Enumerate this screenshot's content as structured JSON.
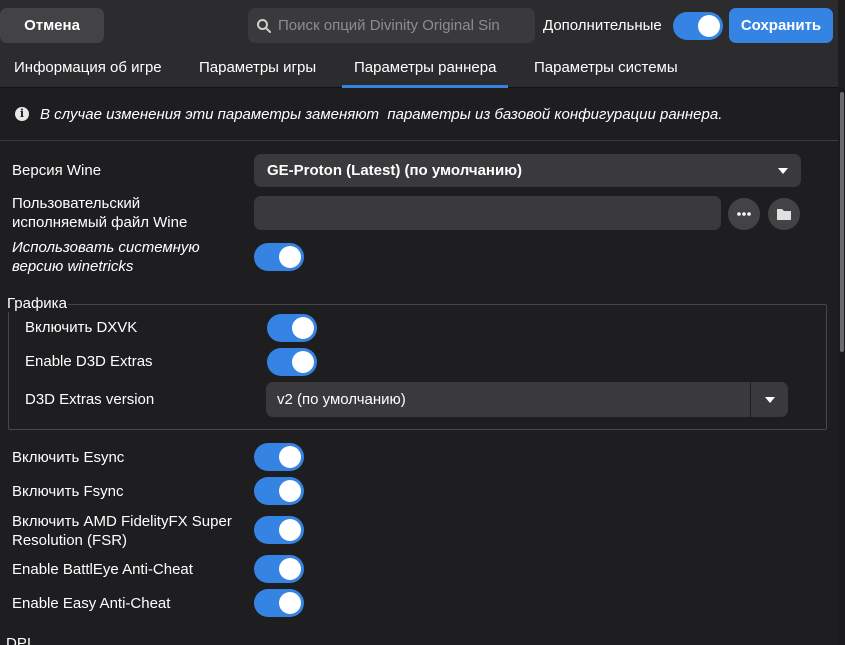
{
  "header": {
    "cancel_label": "Отмена",
    "search_placeholder": "Поиск опций Divinity Original Sin",
    "advanced_label": "Дополнительные",
    "advanced_on": true,
    "save_label": "Сохранить"
  },
  "tabs": [
    {
      "label": "Информация об игре",
      "active": false
    },
    {
      "label": "Параметры игры",
      "active": false
    },
    {
      "label": "Параметры раннера",
      "active": true
    },
    {
      "label": "Параметры системы",
      "active": false
    }
  ],
  "info_text": "В случае изменения эти параметры заменяют  параметры из базовой конфигурации раннера.",
  "wine_version": {
    "label": "Версия Wine",
    "value": "GE-Proton (Latest) (по умолчанию)"
  },
  "custom_wine": {
    "label_line1": "Пользовательский",
    "label_line2": "исполняемый файл Wine",
    "value": ""
  },
  "system_winetricks": {
    "label_line1": "Использовать системную",
    "label_line2": "версию winetricks",
    "on": true
  },
  "graphics": {
    "title": "Графика",
    "dxvk": {
      "label": "Включить DXVK",
      "on": true
    },
    "d3d_extras": {
      "label": "Enable D3D Extras",
      "on": true
    },
    "d3d_version": {
      "label": "D3D Extras version",
      "value": "v2 (по умолчанию)"
    }
  },
  "esync": {
    "label": "Включить Esync",
    "on": true
  },
  "fsync": {
    "label": "Включить Fsync",
    "on": true
  },
  "fsr": {
    "label_line1": "Включить AMD FidelityFX Super",
    "label_line2": "Resolution (FSR)",
    "on": true
  },
  "battleye": {
    "label": "Enable BattlEye Anti-Cheat",
    "on": true
  },
  "eac": {
    "label": "Enable Easy Anti-Cheat",
    "on": true
  },
  "next_section": "DPI",
  "colors": {
    "accent": "#3584e4",
    "background": "#1e1e21",
    "header": "#2c2c2f"
  }
}
